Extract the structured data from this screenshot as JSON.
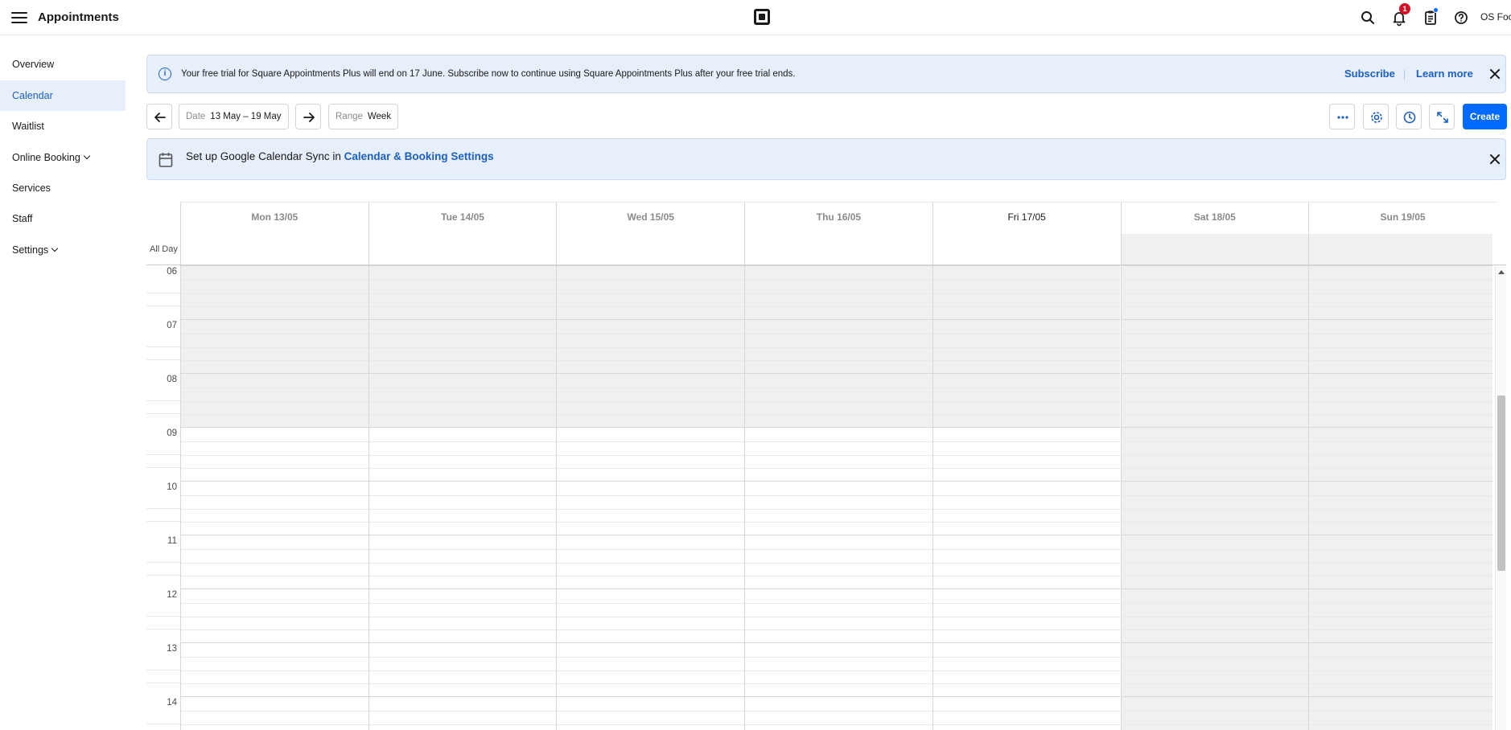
{
  "app": {
    "title": "Appointments",
    "account": "OS Foo"
  },
  "topbar": {
    "icons": [
      "menu-icon",
      "square-logo-icon",
      "search-icon",
      "bell-icon",
      "clipboard-icon",
      "help-icon"
    ],
    "notification_count": "1"
  },
  "sidebar": {
    "items": [
      {
        "label": "Overview"
      },
      {
        "label": "Calendar",
        "active": true
      },
      {
        "label": "Waitlist"
      },
      {
        "label": "Online Booking",
        "has_dropdown": true
      },
      {
        "label": "Services"
      },
      {
        "label": "Staff"
      },
      {
        "label": "Settings",
        "has_dropdown": true
      }
    ]
  },
  "trial_banner": {
    "text": "Your free trial for Square Appointments Plus will end on 17 June. Subscribe now to continue using Square Appointments Plus after your free trial ends.",
    "subscribe": "Subscribe",
    "learn_more": "Learn more"
  },
  "toolbar": {
    "date_label": "Date",
    "date_value": "13 May – 19 May",
    "range_label": "Range",
    "range_value": "Week",
    "create": "Create"
  },
  "sync_banner": {
    "text": "Set up Google Calendar Sync in ",
    "link": "Calendar & Booking Settings"
  },
  "calendar": {
    "all_day_label": "All Day",
    "days": [
      {
        "label": "Mon 13/05",
        "today": false,
        "weekend": false
      },
      {
        "label": "Tue 14/05",
        "today": false,
        "weekend": false
      },
      {
        "label": "Wed 15/05",
        "today": false,
        "weekend": false
      },
      {
        "label": "Thu 16/05",
        "today": false,
        "weekend": false
      },
      {
        "label": "Fri 17/05",
        "today": true,
        "weekend": false
      },
      {
        "label": "Sat 18/05",
        "today": false,
        "weekend": true
      },
      {
        "label": "Sun 19/05",
        "today": false,
        "weekend": true
      }
    ],
    "hours": [
      "06",
      "07",
      "08",
      "09",
      "10",
      "11",
      "12",
      "13",
      "14"
    ],
    "closed_before_hour": "09",
    "colors": {
      "closed_shade": "#f0f0f0",
      "accent": "#006aff",
      "link": "#1c5fc6",
      "banner_bg": "#e6effa"
    }
  }
}
